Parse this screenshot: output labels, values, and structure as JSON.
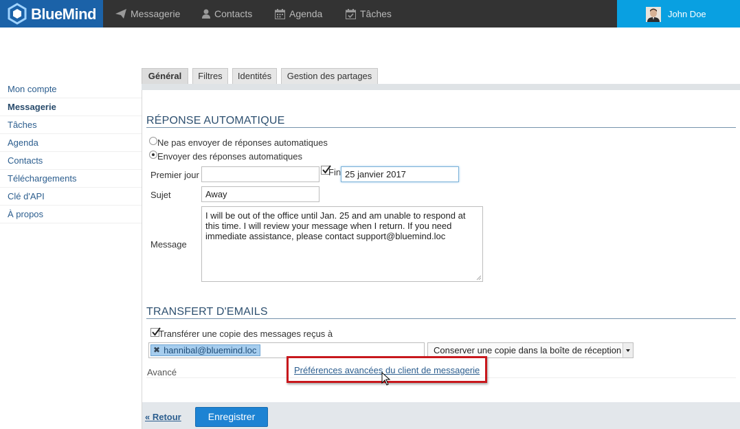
{
  "app": {
    "brand": "BlueMind",
    "brand_color": "#1b62a8",
    "accent": "#09a0e1"
  },
  "nav": [
    {
      "label": "Messagerie",
      "icon": "paper-plane-icon"
    },
    {
      "label": "Contacts",
      "icon": "person-icon"
    },
    {
      "label": "Agenda",
      "icon": "calendar-icon"
    },
    {
      "label": "Tâches",
      "icon": "checklist-icon"
    }
  ],
  "user": {
    "name": "John Doe"
  },
  "sidebar": {
    "items": [
      {
        "label": "Mon compte"
      },
      {
        "label": "Messagerie",
        "active": true
      },
      {
        "label": "Tâches"
      },
      {
        "label": "Agenda"
      },
      {
        "label": "Contacts"
      },
      {
        "label": "Téléchargements"
      },
      {
        "label": "Clé d'API"
      },
      {
        "label": "À propos"
      }
    ]
  },
  "tabs": [
    {
      "label": "Général",
      "active": true
    },
    {
      "label": "Filtres"
    },
    {
      "label": "Identités"
    },
    {
      "label": "Gestion des partages"
    }
  ],
  "autoreply": {
    "title": "RÉPONSE AUTOMATIQUE",
    "option_none": "Ne pas envoyer de réponses automatiques",
    "option_send": "Envoyer des réponses automatiques",
    "first_day_label": "Premier jour",
    "first_day_value": "",
    "end_label": "Fin",
    "end_checked": true,
    "end_value": "25 janvier 2017",
    "subject_label": "Sujet",
    "subject_value": "Away",
    "message_label": "Message",
    "message_value": "I will be out of the office until Jan. 25 and am unable to respond at this time. I will review your message when I return. If you need immediate assistance, please contact support@bluemind.loc"
  },
  "forward": {
    "title": "TRANSFERT D'EMAILS",
    "checkbox_label": "Transférer une copie des messages reçus à",
    "checked": true,
    "recipient": "hannibal@bluemind.loc",
    "keep_copy_option": "Conserver une copie dans la boîte de réception"
  },
  "advanced": {
    "label": "Avancé",
    "link": "Préférences avancées du client de messagerie"
  },
  "footer": {
    "back": "« Retour",
    "save": "Enregistrer"
  }
}
